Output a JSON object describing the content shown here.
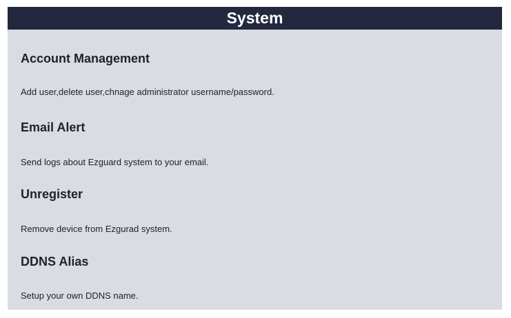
{
  "header": {
    "title": "System"
  },
  "sections": [
    {
      "title": "Account Management",
      "description": "Add user,delete user,chnage administrator username/password."
    },
    {
      "title": "Email Alert",
      "description": "Send logs about Ezguard system to your email."
    },
    {
      "title": "Unregister",
      "description": "Remove device from Ezgurad system."
    },
    {
      "title": "DDNS Alias",
      "description": "Setup your own DDNS name."
    }
  ],
  "colors": {
    "header_background": "#23283e",
    "header_text": "#ffffff",
    "panel_background": "#d9dce3",
    "text": "#222222"
  }
}
